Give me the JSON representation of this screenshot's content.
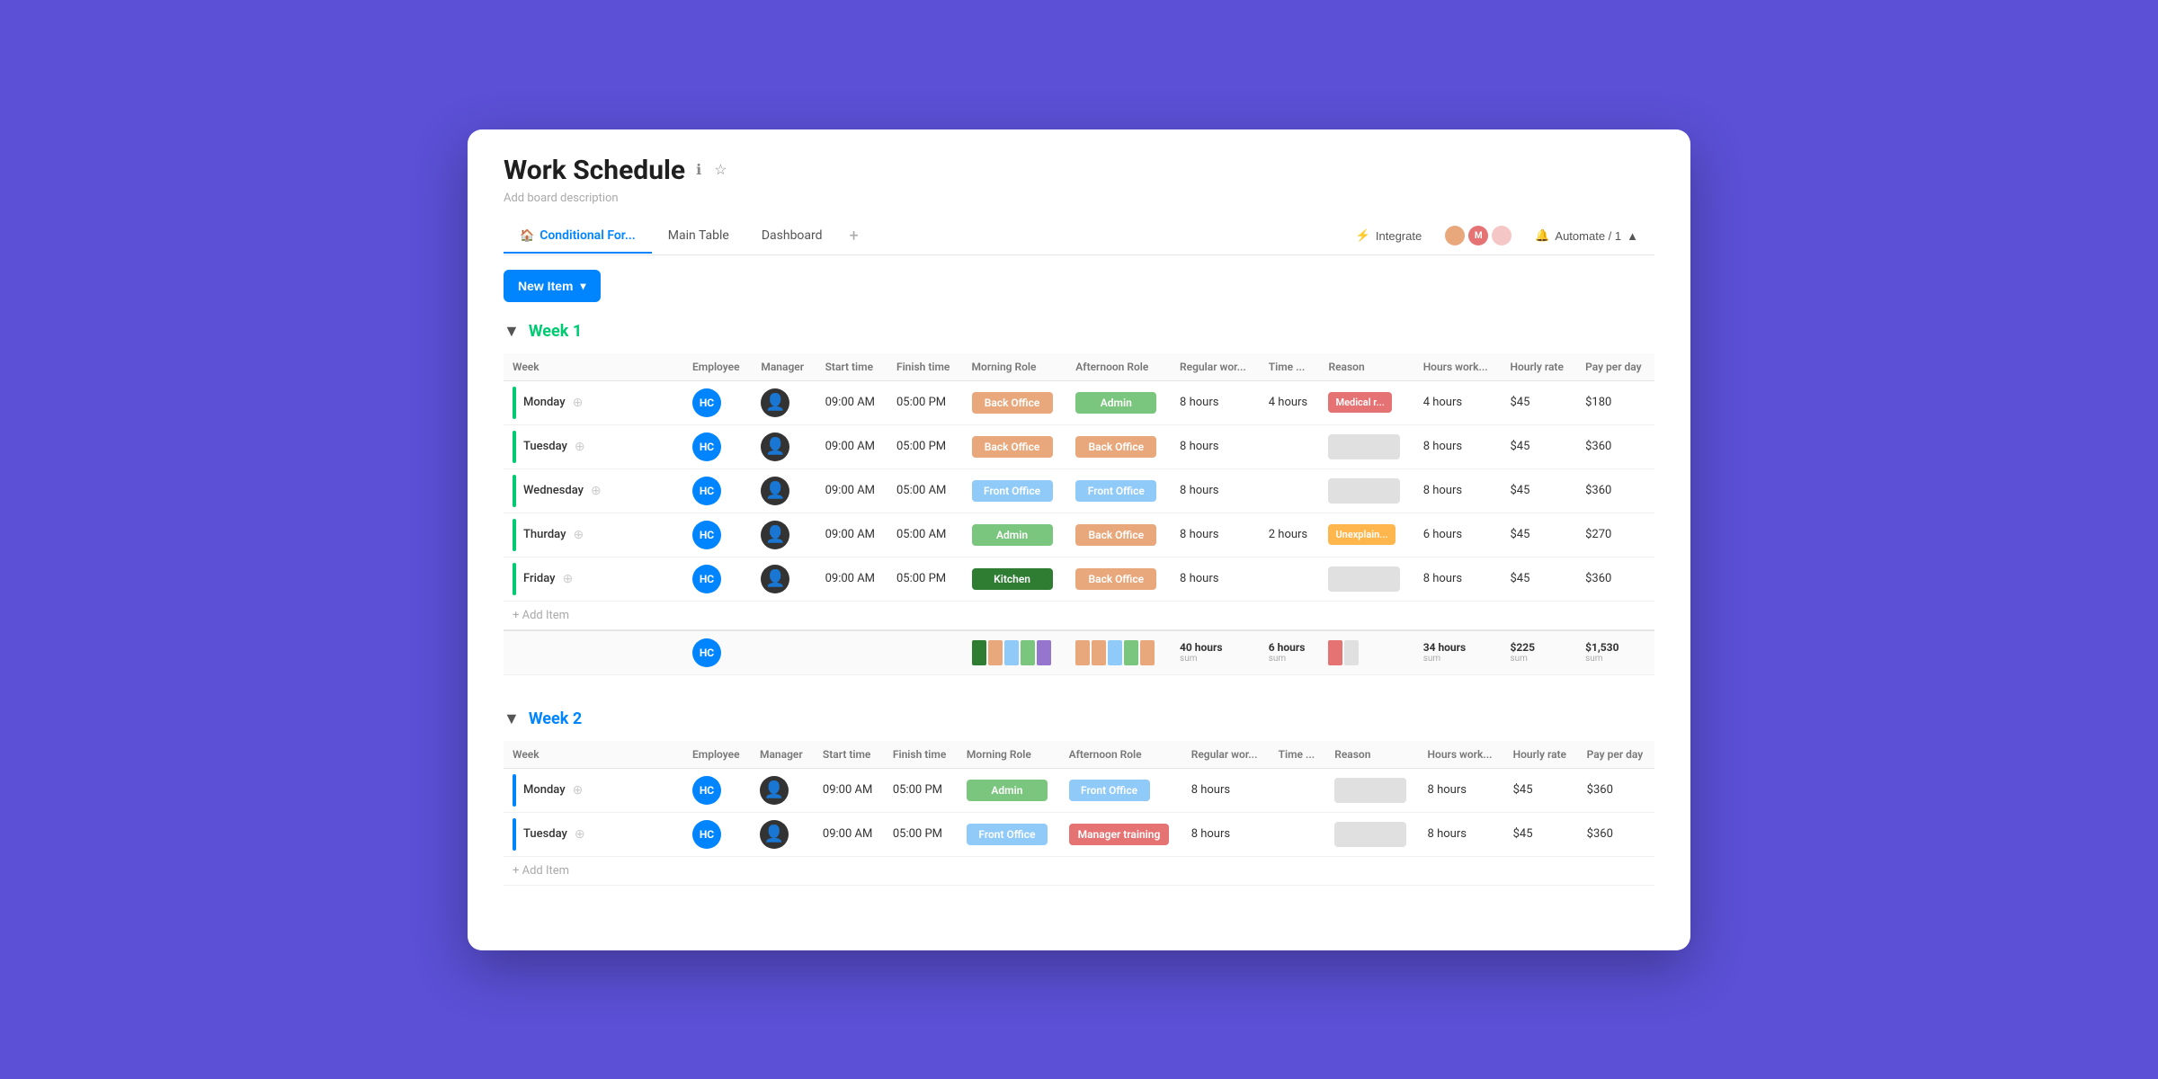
{
  "window": {
    "title": "Work Schedule",
    "description": "Add board description"
  },
  "tabs": [
    {
      "label": "Conditional For...",
      "icon": "🏠",
      "active": true
    },
    {
      "label": "Main Table",
      "active": false
    },
    {
      "label": "Dashboard",
      "active": false
    }
  ],
  "toolbar": {
    "new_item_label": "New Item",
    "integrate_label": "Integrate",
    "automate_label": "Automate / 1"
  },
  "groups": [
    {
      "id": "week1",
      "title": "Week 1",
      "color_class": "green",
      "bar_color": "#00ca72",
      "collapsed": false,
      "columns": [
        "Employee",
        "Manager",
        "Start time",
        "Finish time",
        "Morning Role",
        "Afternoon Role",
        "Regular wor...",
        "Time ...",
        "Reason",
        "Hours work...",
        "Hourly rate",
        "Pay per day"
      ],
      "rows": [
        {
          "day": "Monday",
          "bar_color": "#00ca72",
          "employee_initials": "HC",
          "start": "09:00 AM",
          "finish": "05:00 PM",
          "morning_role": "Back Office",
          "morning_color": "role-back-office",
          "afternoon_role": "Admin",
          "afternoon_color": "role-admin",
          "regular_hours": "8 hours",
          "time_off": "4 hours",
          "reason": "Medical r...",
          "reason_class": "reason-medical",
          "hours_worked": "4 hours",
          "hourly_rate": "$45",
          "pay_per_day": "$180"
        },
        {
          "day": "Tuesday",
          "bar_color": "#00ca72",
          "employee_initials": "HC",
          "start": "09:00 AM",
          "finish": "05:00 PM",
          "morning_role": "Back Office",
          "morning_color": "role-back-office",
          "afternoon_role": "Back Office",
          "afternoon_color": "role-back-office",
          "regular_hours": "8 hours",
          "time_off": "",
          "reason": "",
          "reason_class": "reason-empty",
          "hours_worked": "8 hours",
          "hourly_rate": "$45",
          "pay_per_day": "$360"
        },
        {
          "day": "Wednesday",
          "bar_color": "#00ca72",
          "employee_initials": "HC",
          "start": "09:00 AM",
          "finish": "05:00 AM",
          "morning_role": "Front Office",
          "morning_color": "role-front-office",
          "afternoon_role": "Front Office",
          "afternoon_color": "role-front-office",
          "regular_hours": "8 hours",
          "time_off": "",
          "reason": "",
          "reason_class": "reason-empty",
          "hours_worked": "8 hours",
          "hourly_rate": "$45",
          "pay_per_day": "$360"
        },
        {
          "day": "Thurday",
          "bar_color": "#00ca72",
          "employee_initials": "HC",
          "start": "09:00 AM",
          "finish": "05:00 AM",
          "morning_role": "Admin",
          "morning_color": "role-admin",
          "afternoon_role": "Back Office",
          "afternoon_color": "role-back-office",
          "regular_hours": "8 hours",
          "time_off": "2 hours",
          "reason": "Unexplain...",
          "reason_class": "reason-unexplained",
          "hours_worked": "6 hours",
          "hourly_rate": "$45",
          "pay_per_day": "$270"
        },
        {
          "day": "Friday",
          "bar_color": "#00ca72",
          "employee_initials": "HC",
          "start": "09:00 AM",
          "finish": "05:00 PM",
          "morning_role": "Kitchen",
          "morning_color": "role-kitchen",
          "afternoon_role": "Back Office",
          "afternoon_color": "role-back-office",
          "regular_hours": "8 hours",
          "time_off": "",
          "reason": "",
          "reason_class": "reason-empty",
          "hours_worked": "8 hours",
          "hourly_rate": "$45",
          "pay_per_day": "$360"
        }
      ],
      "summary": {
        "employee_initials": "HC",
        "morning_chips": [
          "#2e7d32",
          "#e8a87c",
          "#90caf9",
          "#7bc67e",
          "#9575cd"
        ],
        "afternoon_chips": [
          "#e8a87c",
          "#e8a87c",
          "#90caf9",
          "#7bc67e",
          "#e8a87c"
        ],
        "regular_hours": "40 hours",
        "time_off": "6 hours",
        "reason_chips": [
          "#e57373",
          "#e0e0e0"
        ],
        "hours_worked": "34 hours",
        "hourly_rate": "$225",
        "pay_per_day": "$1,530"
      }
    },
    {
      "id": "week2",
      "title": "Week 2",
      "color_class": "blue",
      "bar_color": "#0085ff",
      "collapsed": false,
      "columns": [
        "Employee",
        "Manager",
        "Start time",
        "Finish time",
        "Morning Role",
        "Afternoon Role",
        "Regular wor...",
        "Time ...",
        "Reason",
        "Hours work...",
        "Hourly rate",
        "Pay per day"
      ],
      "rows": [
        {
          "day": "Monday",
          "bar_color": "#0085ff",
          "employee_initials": "HC",
          "start": "09:00 AM",
          "finish": "05:00 PM",
          "morning_role": "Admin",
          "morning_color": "role-admin",
          "afternoon_role": "Front Office",
          "afternoon_color": "role-front-office",
          "regular_hours": "8 hours",
          "time_off": "",
          "reason": "",
          "reason_class": "reason-empty",
          "hours_worked": "8 hours",
          "hourly_rate": "$45",
          "pay_per_day": "$360"
        },
        {
          "day": "Tuesday",
          "bar_color": "#0085ff",
          "employee_initials": "HC",
          "start": "09:00 AM",
          "finish": "05:00 PM",
          "morning_role": "Front Office",
          "morning_color": "role-front-office",
          "afternoon_role": "Manager training",
          "afternoon_color": "role-manager-training",
          "regular_hours": "8 hours",
          "time_off": "",
          "reason": "",
          "reason_class": "reason-empty",
          "hours_worked": "8 hours",
          "hourly_rate": "$45",
          "pay_per_day": "$360"
        }
      ],
      "summary": null
    }
  ]
}
